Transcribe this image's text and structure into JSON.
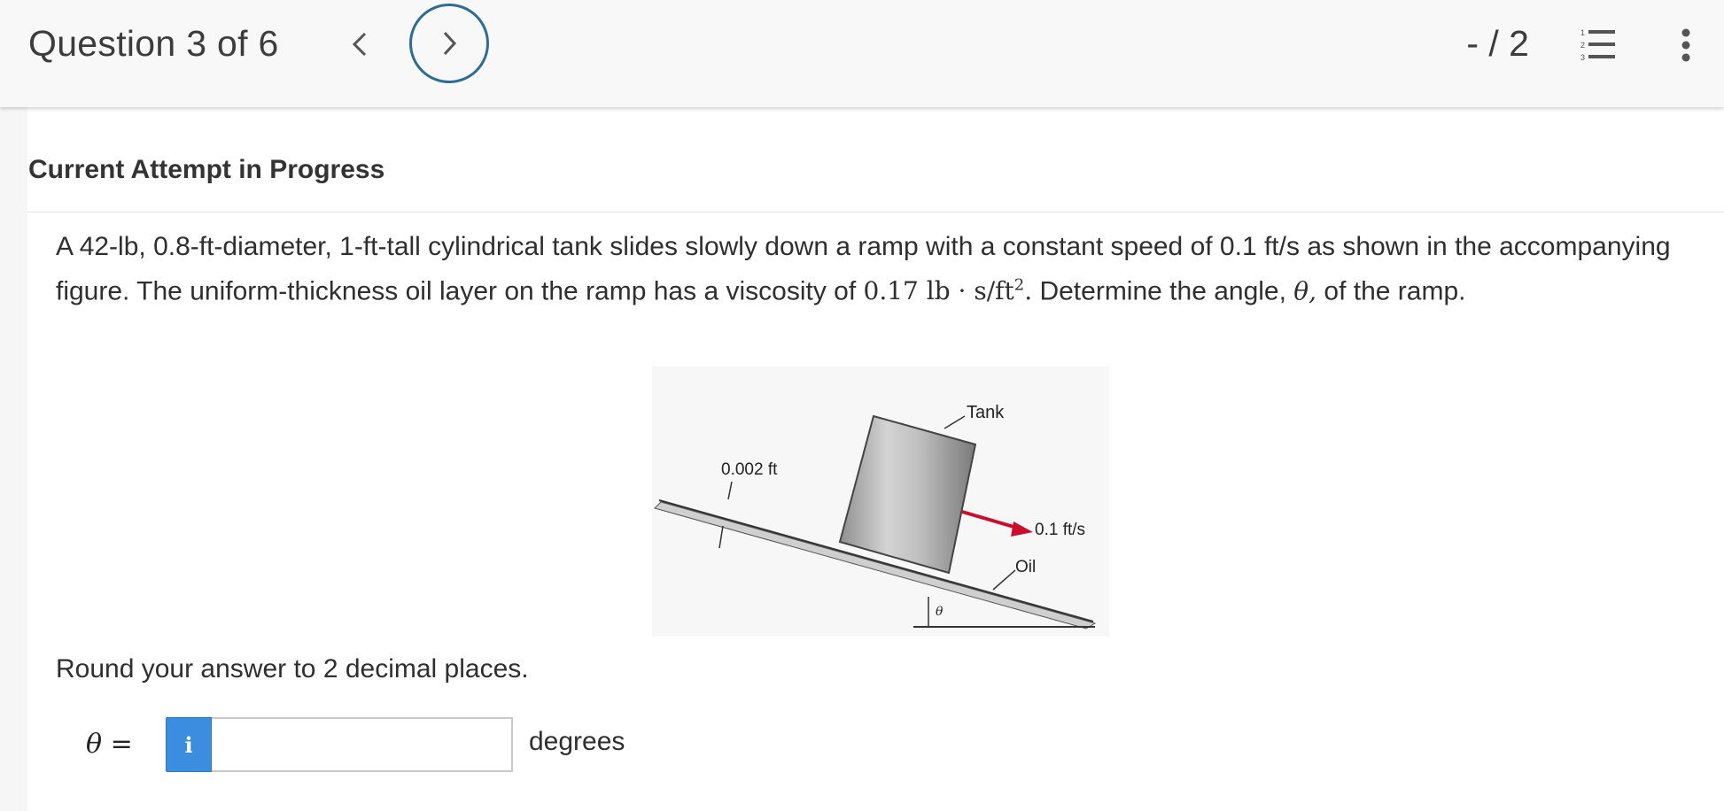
{
  "header": {
    "question_label": "Question 3 of 6",
    "score": "- / 2",
    "prev_icon": "chevron-left-icon",
    "next_icon": "chevron-right-icon",
    "list_icon": "numbered-list-icon",
    "more_icon": "more-vertical-icon",
    "accent_color": "#2e6d93"
  },
  "main": {
    "attempt_title": "Current Attempt in Progress",
    "problem": {
      "text_1": "A 42-lb, 0.8-ft-diameter, 1-ft-tall cylindrical tank slides slowly down a ramp with a constant speed of 0.1 ft/s as shown in the accompanying figure. The uniform-thickness oil layer on the ramp has a viscosity of ",
      "viscosity_num": "0.17 lb · s/ft",
      "viscosity_exp": "2",
      "viscosity_end": ".",
      "text_2": " Determine the angle, ",
      "theta": "θ,",
      "text_3": " of the ramp."
    },
    "figure": {
      "label_tank": "Tank",
      "label_thickness": "0.002 ft",
      "label_speed": "0.1 ft/s",
      "label_oil": "Oil",
      "label_theta": "θ"
    },
    "round_note": "Round your answer to 2 decimal places.",
    "answer": {
      "label": "θ =",
      "info_symbol": "i",
      "input_value": "",
      "input_placeholder": "",
      "unit": "degrees",
      "info_color": "#3b8de0"
    }
  }
}
